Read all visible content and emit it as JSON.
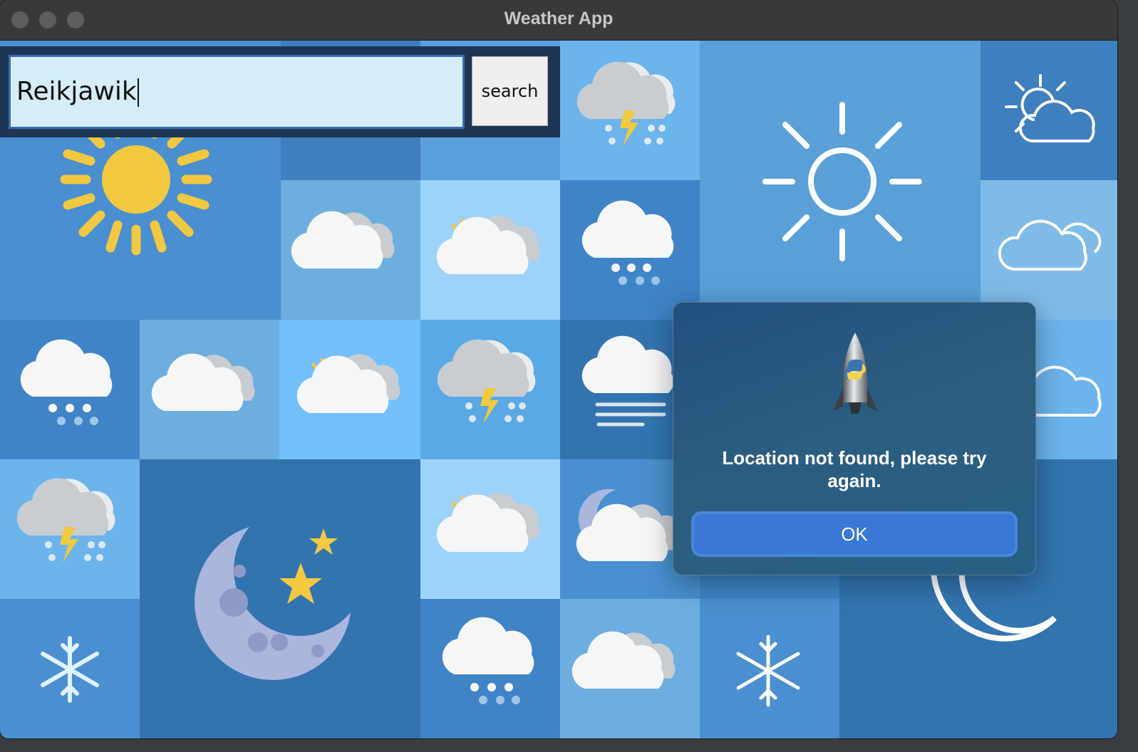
{
  "window": {
    "title": "Weather App",
    "traffic_light_color": "#5c5e60"
  },
  "search": {
    "value": "Reikjawik",
    "button_label": "search"
  },
  "dialog": {
    "icon": "python-rocket-icon",
    "message": "Location not found, please try again.",
    "ok_label": "OK"
  },
  "background": {
    "description_icons": [
      "sun-icon",
      "thunderstorm-icon",
      "snow-cloud-icon",
      "cloud-icon",
      "partly-sunny-icon",
      "fog-icon",
      "moon-stars-icon",
      "snowflake-icon",
      "sun-outline-icon",
      "cloud-outline-icon",
      "moon-outline-icon",
      "moon-cloud-icon"
    ],
    "colors": {
      "dark": "#3374b0",
      "mid": "#4a8fcf",
      "light": "#6cb4ec",
      "pale": "#9dd2fb",
      "sun": "#f2c840",
      "cloud": "#f4f6f8",
      "cloud_gray": "#c8cdd2",
      "moon": "#aab6de",
      "star": "#f5c842"
    }
  }
}
